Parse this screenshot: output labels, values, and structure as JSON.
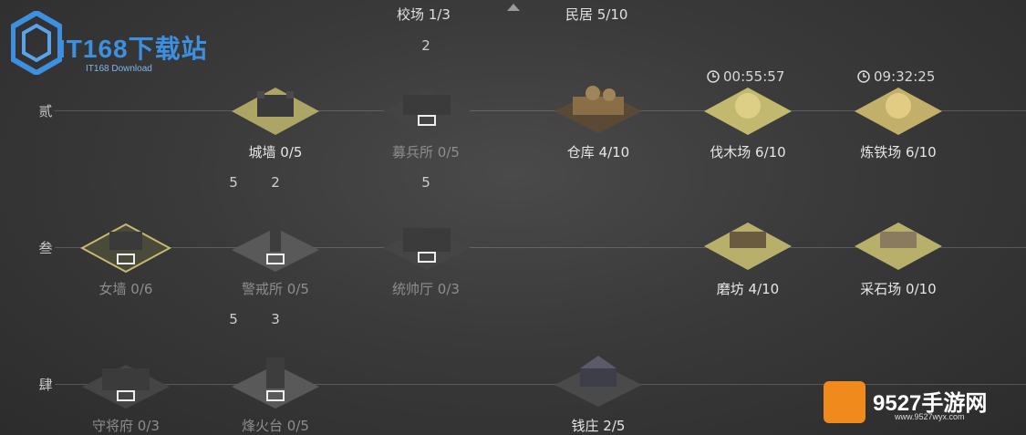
{
  "header": {
    "training_ground": "校场 1/3",
    "residence": "民居 5/10"
  },
  "rows": {
    "row2_label": "贰",
    "row3_label": "叁",
    "row4_label": "肆"
  },
  "buildings": {
    "city_wall": "城墙 0/5",
    "recruit_office": "募兵所 0/5",
    "warehouse": "仓库 4/10",
    "lumber_yard": "伐木场 6/10",
    "smithy": "炼铁场 6/10",
    "parapet": "女墙 0/6",
    "guard_post": "警戒所 0/5",
    "command_hall": "统帅厅 0/3",
    "mill": "磨坊 4/10",
    "quarry": "采石场 0/10",
    "general_mansion": "守将府 0/3",
    "beacon_tower": "烽火台 0/5",
    "bank": "钱庄 2/5"
  },
  "requirements": {
    "recruit_office_req": "2",
    "guard_post_req_a": "5",
    "guard_post_req_b": "2",
    "command_hall_req": "5",
    "beacon_req_a": "5",
    "beacon_req_b": "3"
  },
  "timers": {
    "lumber_yard": "00:55:57",
    "smithy": "09:32:25"
  },
  "watermarks": {
    "it168_title": "IT168下载站",
    "it168_sub": "IT168 Download",
    "site_title": "9527手游网",
    "site_sub": "www.9527wyx.com"
  },
  "colors": {
    "active_tile": "#b8b06a",
    "inactive_tile": "#6e6e6e",
    "accent_logo": "#3d8fe0"
  }
}
